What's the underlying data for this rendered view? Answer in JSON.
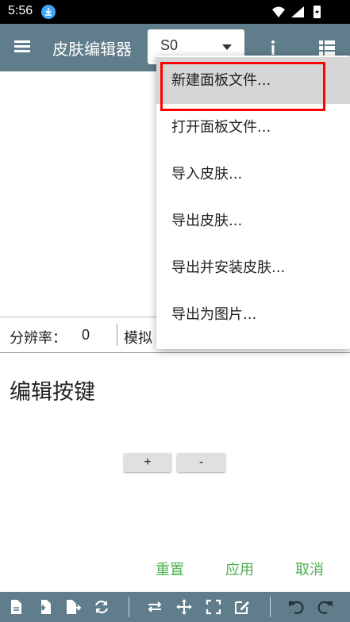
{
  "status_bar": {
    "time": "5:56"
  },
  "app_bar": {
    "title": "皮肤编辑器",
    "dropdown_value": "S0"
  },
  "info_bar": {
    "resolution_label": "分辨率：",
    "resolution_value": "0",
    "mode_label": "模拟"
  },
  "editor": {
    "title": "编辑按键",
    "plus_label": "+",
    "minus_label": "-"
  },
  "actions": {
    "reset": "重置",
    "apply": "应用",
    "cancel": "取消"
  },
  "menu": {
    "items": [
      {
        "label": "新建面板文件..."
      },
      {
        "label": "打开面板文件..."
      },
      {
        "label": "导入皮肤..."
      },
      {
        "label": "导出皮肤..."
      },
      {
        "label": "导出并安装皮肤..."
      },
      {
        "label": "导出为图片..."
      }
    ]
  },
  "colors": {
    "app_bar": "#607d8b",
    "accent_green": "#4caf50",
    "highlight_box": "#ff0000"
  }
}
